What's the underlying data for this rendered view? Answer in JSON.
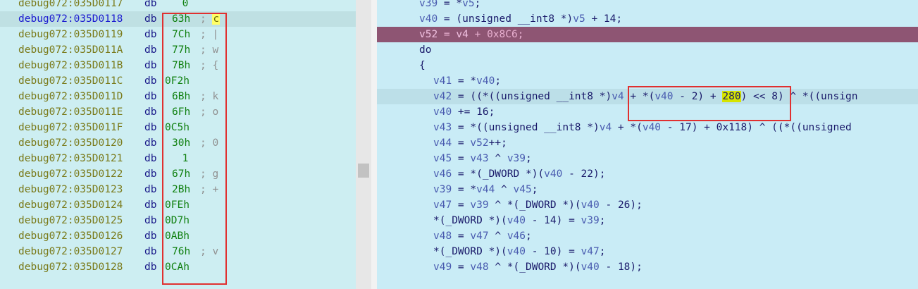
{
  "hex_view": {
    "rows": [
      {
        "addr": "debug072:035D0117",
        "db": "db",
        "val": "0",
        "cmt": "",
        "chr": ""
      },
      {
        "addr": "debug072:035D0118",
        "db": "db",
        "val": "63h",
        "cmt": ";",
        "chr": "c"
      },
      {
        "addr": "debug072:035D0119",
        "db": "db",
        "val": "7Ch",
        "cmt": "; |",
        "chr": ""
      },
      {
        "addr": "debug072:035D011A",
        "db": "db",
        "val": "77h",
        "cmt": "; w",
        "chr": ""
      },
      {
        "addr": "debug072:035D011B",
        "db": "db",
        "val": "7Bh",
        "cmt": "; {",
        "chr": ""
      },
      {
        "addr": "debug072:035D011C",
        "db": "db",
        "val": "0F2h",
        "cmt": "",
        "chr": ""
      },
      {
        "addr": "debug072:035D011D",
        "db": "db",
        "val": "6Bh",
        "cmt": "; k",
        "chr": ""
      },
      {
        "addr": "debug072:035D011E",
        "db": "db",
        "val": "6Fh",
        "cmt": "; o",
        "chr": ""
      },
      {
        "addr": "debug072:035D011F",
        "db": "db",
        "val": "0C5h",
        "cmt": "",
        "chr": ""
      },
      {
        "addr": "debug072:035D0120",
        "db": "db",
        "val": "30h",
        "cmt": "; 0",
        "chr": ""
      },
      {
        "addr": "debug072:035D0121",
        "db": "db",
        "val": "1",
        "cmt": "",
        "chr": ""
      },
      {
        "addr": "debug072:035D0122",
        "db": "db",
        "val": "67h",
        "cmt": "; g",
        "chr": ""
      },
      {
        "addr": "debug072:035D0123",
        "db": "db",
        "val": "2Bh",
        "cmt": "; +",
        "chr": ""
      },
      {
        "addr": "debug072:035D0124",
        "db": "db",
        "val": "0FEh",
        "cmt": "",
        "chr": ""
      },
      {
        "addr": "debug072:035D0125",
        "db": "db",
        "val": "0D7h",
        "cmt": "",
        "chr": ""
      },
      {
        "addr": "debug072:035D0126",
        "db": "db",
        "val": "0ABh",
        "cmt": "",
        "chr": ""
      },
      {
        "addr": "debug072:035D0127",
        "db": "db",
        "val": "76h",
        "cmt": "; v",
        "chr": ""
      },
      {
        "addr": "debug072:035D0128",
        "db": "db",
        "val": "0CAh",
        "cmt": "",
        "chr": ""
      }
    ]
  },
  "pseudocode": {
    "lines": [
      {
        "indent": 0,
        "text": "v39 = *v5;"
      },
      {
        "indent": 0,
        "text": "v40 = (unsigned __int8 *)v5 + 14;"
      },
      {
        "indent": 0,
        "text": "v52 = v4 + 0x8C6;",
        "state": "cur"
      },
      {
        "indent": 0,
        "text": "do"
      },
      {
        "indent": 0,
        "text": "{"
      },
      {
        "indent": 1,
        "text": "v41 = *v40;"
      },
      {
        "indent": 1,
        "pre": "v42 = ((*((unsigned __int8 *)v4 + *(v40 - 2) + ",
        "hl": "280",
        "post": ") << 8) ^ *((unsign",
        "state": "sel"
      },
      {
        "indent": 1,
        "text": "v40 += 16;"
      },
      {
        "indent": 1,
        "text": "v43 = *((unsigned __int8 *)v4 + *(v40 - 17) + 0x118) ^ ((*((unsigned"
      },
      {
        "indent": 1,
        "text": "v44 = v52++;"
      },
      {
        "indent": 1,
        "text": "v45 = v43 ^ v39;"
      },
      {
        "indent": 1,
        "text": "v46 = *(_DWORD *)(v40 - 22);"
      },
      {
        "indent": 1,
        "text": "v39 = *v44 ^ v45;"
      },
      {
        "indent": 1,
        "text": "v47 = v39 ^ *(_DWORD *)(v40 - 26);"
      },
      {
        "indent": 1,
        "text": "*(_DWORD *)(v40 - 14) = v39;"
      },
      {
        "indent": 1,
        "text": "v48 = v47 ^ v46;"
      },
      {
        "indent": 1,
        "text": "*(_DWORD *)(v40 - 10) = v47;"
      },
      {
        "indent": 1,
        "text": "v49 = v48 ^ *(_DWORD *)(v40 - 18);"
      }
    ]
  }
}
